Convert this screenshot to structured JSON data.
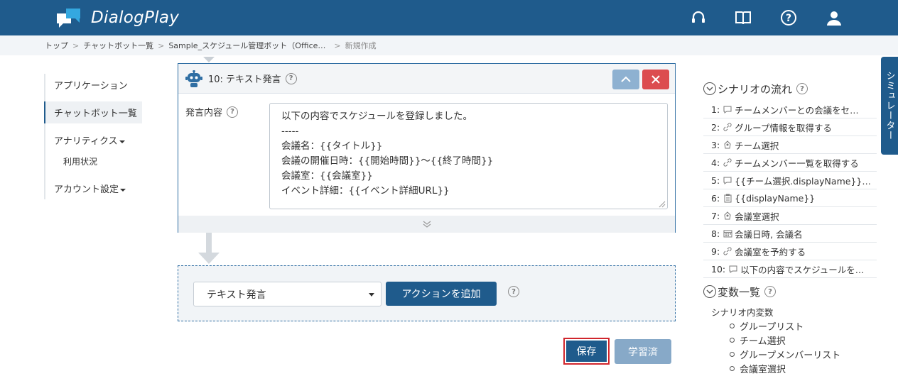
{
  "header": {
    "app_name": "DialogPlay",
    "icons": [
      "headset-icon",
      "book-icon",
      "help-icon",
      "user-icon"
    ]
  },
  "breadcrumb": {
    "items": [
      "トップ",
      "チャットボット一覧",
      "Sample_スケジュール管理ボット（Office…",
      "新規作成"
    ]
  },
  "sidebar": {
    "items": [
      {
        "label": "アプリケーション"
      },
      {
        "label": "チャットボット一覧"
      },
      {
        "label": "アナリティクス"
      },
      {
        "label": "利用状況"
      },
      {
        "label": "アカウント設定"
      }
    ]
  },
  "action_card": {
    "title": "10: テキスト発言",
    "field_label": "発言内容",
    "message": "以下の内容でスケジュールを登録しました。\n-----\n会議名：{{タイトル}}\n会議の開催日時：{{開始時間}}～{{終了時間}}\n会議室：{{会議室}}\nイベント詳細：{{イベント詳細URL}}"
  },
  "add_action": {
    "selected": "テキスト発言",
    "button_label": "アクションを追加"
  },
  "footer_buttons": {
    "save": "保存",
    "learned": "学習済"
  },
  "scenario_flow": {
    "title": "シナリオの流れ",
    "items": [
      {
        "num": "1:",
        "icon": "speech-icon",
        "label": "チームメンバーとの会議をセ…"
      },
      {
        "num": "2:",
        "icon": "link-icon",
        "label": "グループ情報を取得する"
      },
      {
        "num": "3:",
        "icon": "select-icon",
        "label": "チーム選択"
      },
      {
        "num": "4:",
        "icon": "link-icon",
        "label": "チームメンバー一覧を取得する"
      },
      {
        "num": "5:",
        "icon": "speech-icon",
        "label": "{{チーム選択.displayName}}…"
      },
      {
        "num": "6:",
        "icon": "clipboard-icon",
        "label": "{{displayName}}"
      },
      {
        "num": "7:",
        "icon": "select-icon",
        "label": "会議室選択"
      },
      {
        "num": "8:",
        "icon": "calendar-icon",
        "label": "会議日時, 会議名"
      },
      {
        "num": "9:",
        "icon": "link-icon",
        "label": "会議室を予約する"
      },
      {
        "num": "10:",
        "icon": "speech-icon",
        "label": "以下の内容でスケジュールを…"
      }
    ]
  },
  "variables": {
    "title": "変数一覧",
    "subtitle": "シナリオ内変数",
    "items": [
      "グループリスト",
      "チーム選択",
      "グループメンバーリスト",
      "会議室選択"
    ]
  },
  "simulator_tab": "シミュレーター"
}
